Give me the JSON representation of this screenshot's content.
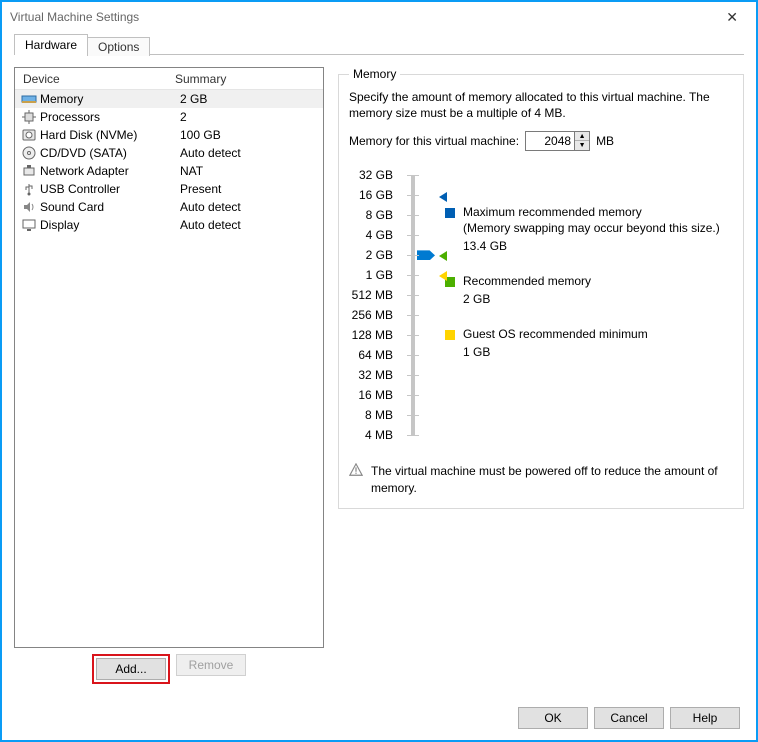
{
  "window": {
    "title": "Virtual Machine Settings"
  },
  "tabs": {
    "hardware": "Hardware",
    "options": "Options"
  },
  "devlist": {
    "col1": "Device",
    "col2": "Summary",
    "rows": [
      {
        "name": "Memory",
        "summary": "2 GB",
        "icon": "memory"
      },
      {
        "name": "Processors",
        "summary": "2",
        "icon": "cpu"
      },
      {
        "name": "Hard Disk (NVMe)",
        "summary": "100 GB",
        "icon": "disk"
      },
      {
        "name": "CD/DVD (SATA)",
        "summary": "Auto detect",
        "icon": "cd"
      },
      {
        "name": "Network Adapter",
        "summary": "NAT",
        "icon": "net"
      },
      {
        "name": "USB Controller",
        "summary": "Present",
        "icon": "usb"
      },
      {
        "name": "Sound Card",
        "summary": "Auto detect",
        "icon": "sound"
      },
      {
        "name": "Display",
        "summary": "Auto detect",
        "icon": "display"
      }
    ]
  },
  "buttons": {
    "add": "Add...",
    "remove": "Remove",
    "ok": "OK",
    "cancel": "Cancel",
    "help": "Help"
  },
  "memory": {
    "legend": "Memory",
    "desc": "Specify the amount of memory allocated to this virtual machine. The memory size must be a multiple of 4 MB.",
    "input_label": "Memory for this virtual machine:",
    "value": "2048",
    "unit": "MB",
    "scale": [
      "32 GB",
      "16 GB",
      "8 GB",
      "4 GB",
      "2 GB",
      "1 GB",
      "512 MB",
      "256 MB",
      "128 MB",
      "64 MB",
      "32 MB",
      "16 MB",
      "8 MB",
      "4 MB"
    ],
    "legend_items": {
      "max": {
        "label": "Maximum recommended memory",
        "note": "(Memory swapping may occur beyond this size.)",
        "value": "13.4 GB"
      },
      "rec": {
        "label": "Recommended memory",
        "value": "2 GB"
      },
      "min": {
        "label": "Guest OS recommended minimum",
        "value": "1 GB"
      }
    },
    "warn": "The virtual machine must be powered off to reduce the amount of memory."
  }
}
